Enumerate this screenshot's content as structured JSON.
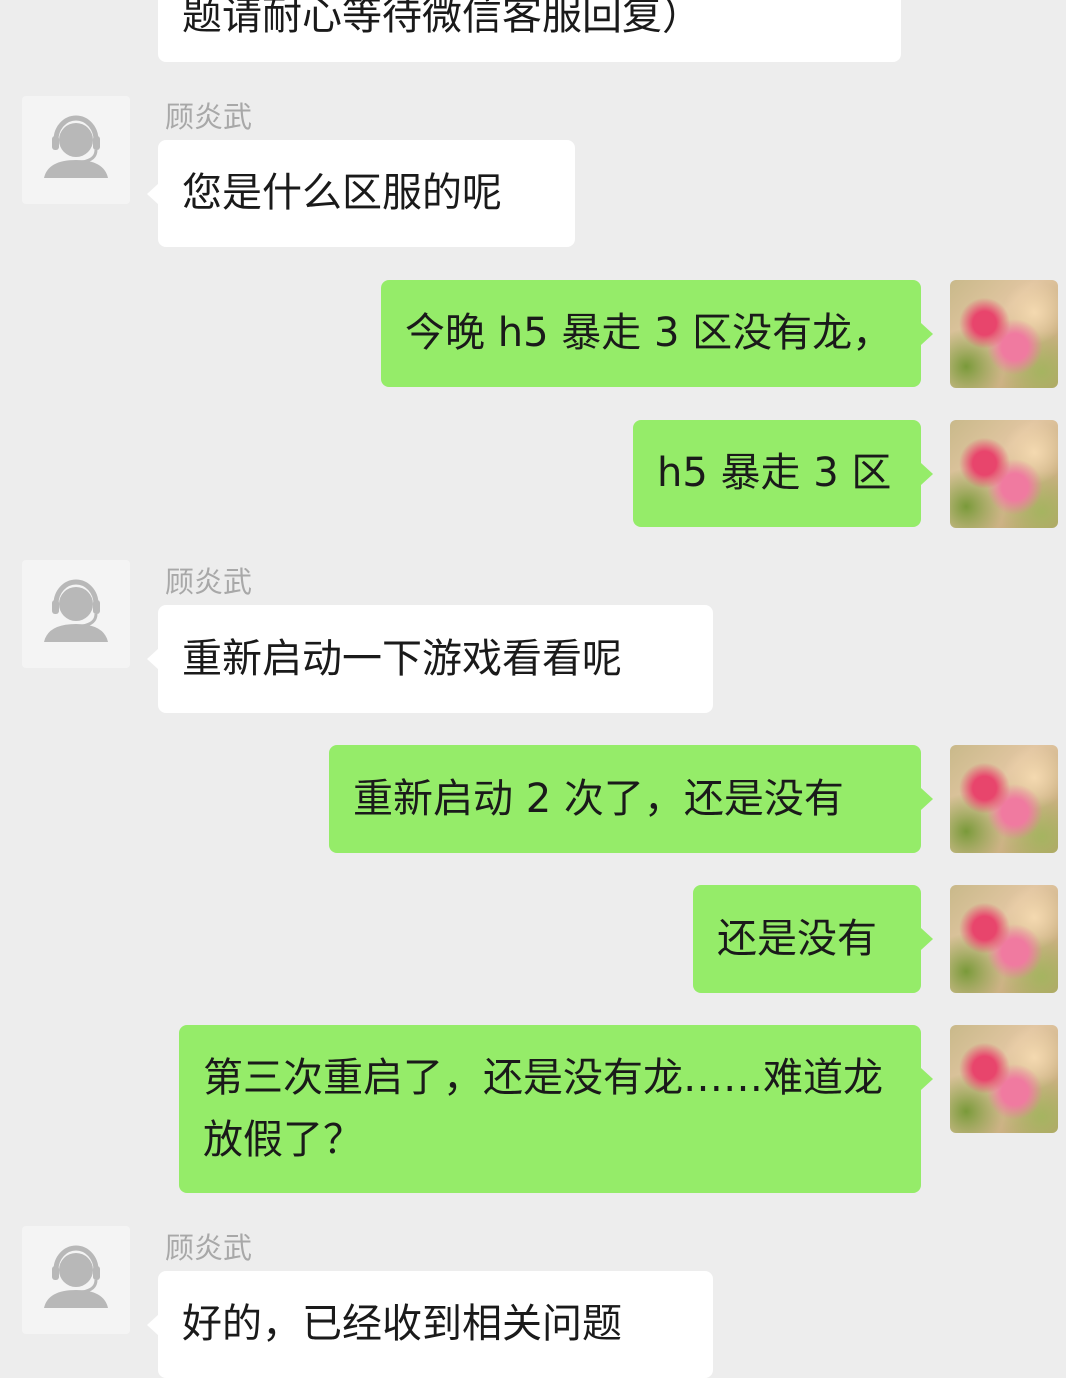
{
  "agent_name": "顾炎武",
  "messages": {
    "m0": "题请耐心等待微信客服回复）",
    "m1": "您是什么区服的呢",
    "m2": "今晚 h5 暴走 3 区没有龙，",
    "m3": "h5 暴走 3 区",
    "m4": "重新启动一下游戏看看呢",
    "m5": "重新启动 2 次了，还是没有",
    "m6": "还是没有",
    "m7": "第三次重启了，还是没有龙……难道龙放假了？",
    "m8": "好的，已经收到相关问题"
  },
  "colors": {
    "background": "#ededed",
    "incoming_bubble": "#ffffff",
    "outgoing_bubble": "#95ec69",
    "sender_name": "#a8a8a8"
  },
  "icons": {
    "agent_avatar": "customer-service-headset-icon",
    "user_avatar": "pink-flower-photo"
  }
}
